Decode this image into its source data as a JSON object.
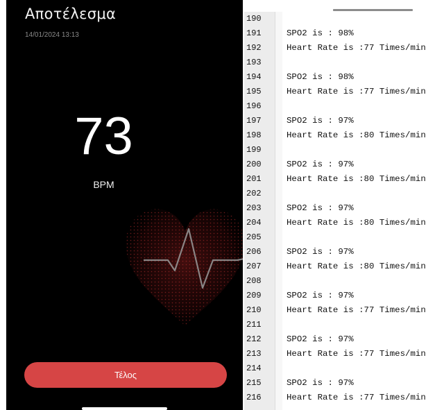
{
  "phone": {
    "title": "Αποτέλεσμα",
    "datetime": "14/01/2024 13:13",
    "bpm_value": "73",
    "bpm_unit": "BPM",
    "end_button": "Τέλος",
    "accent_color": "#d64545"
  },
  "editor": {
    "lines": [
      {
        "n": "190",
        "text": ""
      },
      {
        "n": "191",
        "text": "SPO2 is : 98%"
      },
      {
        "n": "192",
        "text": "Heart Rate is :77 Times/min"
      },
      {
        "n": "193",
        "text": ""
      },
      {
        "n": "194",
        "text": "SPO2 is : 98%"
      },
      {
        "n": "195",
        "text": "Heart Rate is :77 Times/min"
      },
      {
        "n": "196",
        "text": ""
      },
      {
        "n": "197",
        "text": "SPO2 is : 97%"
      },
      {
        "n": "198",
        "text": "Heart Rate is :80 Times/min"
      },
      {
        "n": "199",
        "text": ""
      },
      {
        "n": "200",
        "text": "SPO2 is : 97%"
      },
      {
        "n": "201",
        "text": "Heart Rate is :80 Times/min"
      },
      {
        "n": "202",
        "text": ""
      },
      {
        "n": "203",
        "text": "SPO2 is : 97%"
      },
      {
        "n": "204",
        "text": "Heart Rate is :80 Times/min"
      },
      {
        "n": "205",
        "text": ""
      },
      {
        "n": "206",
        "text": "SPO2 is : 97%"
      },
      {
        "n": "207",
        "text": "Heart Rate is :80 Times/min"
      },
      {
        "n": "208",
        "text": ""
      },
      {
        "n": "209",
        "text": "SPO2 is : 97%"
      },
      {
        "n": "210",
        "text": "Heart Rate is :77 Times/min"
      },
      {
        "n": "211",
        "text": ""
      },
      {
        "n": "212",
        "text": "SPO2 is : 97%"
      },
      {
        "n": "213",
        "text": "Heart Rate is :77 Times/min"
      },
      {
        "n": "214",
        "text": ""
      },
      {
        "n": "215",
        "text": "SPO2 is : 97%"
      },
      {
        "n": "216",
        "text": "Heart Rate is :77 Times/min"
      }
    ]
  }
}
